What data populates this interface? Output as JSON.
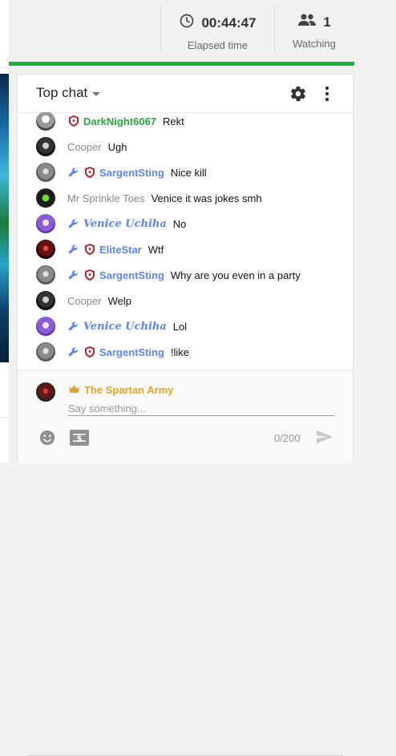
{
  "stats": {
    "elapsed": {
      "value": "00:44:47",
      "label": "Elapsed time",
      "icon": "clock-icon"
    },
    "watching": {
      "value": "1",
      "label": "Watching",
      "icon": "people-icon"
    }
  },
  "chat": {
    "title": "Top chat",
    "messages": [
      {
        "author": "DarkNight6067",
        "text": "Rekt",
        "badges": [
          "shield"
        ],
        "style": "green"
      },
      {
        "author": "Cooper",
        "text": "Ugh",
        "badges": [],
        "style": "grey"
      },
      {
        "author": "SargentSting",
        "text": "Nice kill",
        "badges": [
          "wrench",
          "shield"
        ],
        "style": "mod"
      },
      {
        "author": "Mr Sprinkle Toes",
        "text": "Venice it was jokes smh",
        "badges": [],
        "style": "grey"
      },
      {
        "author": "Venice Uchiha",
        "text": "No",
        "badges": [
          "wrench"
        ],
        "style": "script"
      },
      {
        "author": "EliteStar",
        "text": "Wtf",
        "badges": [
          "wrench",
          "shield"
        ],
        "style": "mod"
      },
      {
        "author": "SargentSting",
        "text": "Why are you even in a party",
        "badges": [
          "wrench",
          "shield"
        ],
        "style": "mod"
      },
      {
        "author": "Cooper",
        "text": "Welp",
        "badges": [],
        "style": "grey"
      },
      {
        "author": "Venice Uchiha",
        "text": "Lol",
        "badges": [
          "wrench"
        ],
        "style": "script"
      },
      {
        "author": "SargentSting",
        "text": "!like",
        "badges": [
          "wrench",
          "shield"
        ],
        "style": "mod"
      }
    ],
    "input": {
      "user": "The Spartan Army",
      "placeholder": "Say something...",
      "counter": "0/200"
    }
  },
  "colors": {
    "progress": "#1fb33b",
    "moderator": "#5e84f1",
    "owner": "#e0a430",
    "member_green": "#2ba640"
  }
}
